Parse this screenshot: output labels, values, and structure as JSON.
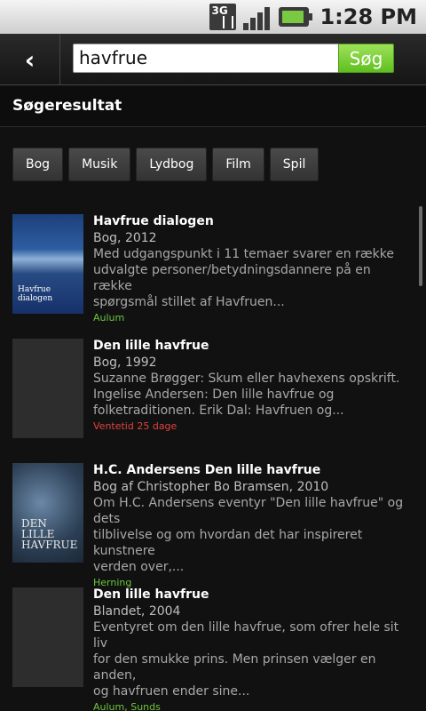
{
  "status_bar": {
    "network": "3G",
    "time": "1:28 PM"
  },
  "search": {
    "back_icon": "chevron-left-icon",
    "query": "havfrue",
    "button_label": "Søg"
  },
  "section_title": "Søgeresultat",
  "filters": [
    "Bog",
    "Musik",
    "Lydbog",
    "Film",
    "Spil"
  ],
  "results": [
    {
      "title": "Havfrue dialogen",
      "meta": "Bog, 2012",
      "desc": [
        "Med udgangspunkt i 11 temaer svarer en række",
        "udvalgte personer/betydningsdannere på en række",
        "spørgsmål stillet af Havfruen..."
      ],
      "availability": "Aulum",
      "availability_color": "#6cc63c",
      "cover_text": "Havfrue dialogen"
    },
    {
      "title": "Den lille havfrue",
      "meta": "Bog, 1992",
      "desc": [
        "Suzanne Brøgger: Skum eller havhexens opskrift.",
        "Ingelise Andersen: Den lille havfrue og",
        "folketraditionen. Erik Dal: Havfruen og..."
      ],
      "availability": "Ventetid 25 dage",
      "availability_color": "#e0433f",
      "cover_text": ""
    },
    {
      "title": "H.C. Andersens Den lille havfrue",
      "meta": "Bog af Christopher Bo Bramsen, 2010",
      "desc": [
        "Om H.C. Andersens eventyr \"Den lille havfrue\" og dets",
        "tilblivelse og om hvordan det har inspireret kunstnere",
        "verden over,..."
      ],
      "availability": "Herning",
      "availability_color": "#6cc63c",
      "cover_text": "DEN LILLE HAVFRUE"
    },
    {
      "title": "Den lille havfrue",
      "meta": "Blandet, 2004",
      "desc": [
        "Eventyret om den lille havfrue, som ofrer hele sit liv",
        "for den smukke prins. Men prinsen vælger en anden,",
        "og havfruen ender sine..."
      ],
      "availability": "Aulum, Sunds",
      "availability_color": "#6cc63c",
      "cover_text": ""
    }
  ]
}
